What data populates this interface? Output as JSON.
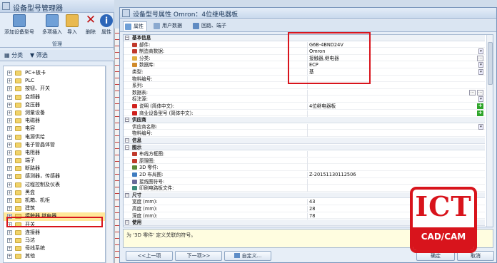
{
  "left_window": {
    "title": "设备型号管理器",
    "toolbar": [
      {
        "label": "添加设备型号",
        "icon": "add-device-icon"
      },
      {
        "label": "多项插入",
        "icon": "multi-insert-icon"
      },
      {
        "label": "导入",
        "icon": "import-icon"
      },
      {
        "label": "删除",
        "icon": "delete-icon"
      },
      {
        "label": "属性",
        "icon": "info-icon"
      }
    ],
    "group_label": "管理",
    "tabs": [
      "分类",
      "筛选"
    ],
    "tree": [
      "PC+板卡",
      "PLC",
      "按钮、开关",
      "变频器",
      "变压器",
      "测量设备",
      "电磁器",
      "电容",
      "电源供给",
      "电子管晶体管",
      "电阻器",
      "端子",
      "断路器",
      "感测器，传感器",
      "过程控制及仪表",
      "黑盒",
      "机箱、机柜",
      "建筑",
      "接触器,继电器",
      "开关",
      "连接器",
      "马达",
      "母线系统",
      "其他"
    ],
    "selected_item": "接触器,继电器"
  },
  "right_window": {
    "title": "设备型号属性 Omron：4位继电器板",
    "tabs": [
      "属性",
      "用户数据",
      "回路、端子"
    ],
    "properties": [
      {
        "type": "cat",
        "label": "基本信息"
      },
      {
        "label": "部件:",
        "value": "G6B-4BND24V",
        "icon": "pencil-icon",
        "ctrl": ""
      },
      {
        "label": "制造商数据:",
        "value": "Omron",
        "icon": "pencil-icon",
        "ctrl": "dropdown"
      },
      {
        "label": "分类:",
        "value": "接触器,继电器",
        "icon": "folder-icon",
        "ctrl": "ellipsis"
      },
      {
        "label": "数据库:",
        "value": "ECP",
        "icon": "db-icon",
        "ctrl": "dropdown"
      },
      {
        "label": "类型:",
        "value": "基",
        "icon": "",
        "ctrl": "dropdown"
      },
      {
        "label": "物料编号:",
        "value": "",
        "icon": "",
        "ctrl": ""
      },
      {
        "label": "系列:",
        "value": "",
        "icon": "",
        "ctrl": ""
      },
      {
        "label": "数据表:",
        "value": "",
        "icon": "",
        "ctrl": "ellipsis2"
      },
      {
        "label": "标注源:",
        "value": "",
        "icon": "",
        "ctrl": "dropdown"
      },
      {
        "label": "说明 (简体中文):",
        "value": "4位继电器板",
        "icon": "flag-icon",
        "ctrl": "plus"
      },
      {
        "label": "商业设备型号 (简体中文):",
        "value": "",
        "icon": "flag-icon",
        "ctrl": "plus"
      },
      {
        "type": "cat",
        "label": "供应商"
      },
      {
        "label": "供应商名称:",
        "value": "",
        "icon": "",
        "ctrl": "dropdown"
      },
      {
        "label": "物料编号:",
        "value": "",
        "icon": "",
        "ctrl": ""
      },
      {
        "type": "cat",
        "label": "信息"
      },
      {
        "type": "cat",
        "label": "图示"
      },
      {
        "label": "布线方框图:",
        "value": "",
        "icon": "pencil-icon",
        "ctrl": ""
      },
      {
        "label": "原理图:",
        "value": "",
        "icon": "pencil-icon",
        "ctrl": ""
      },
      {
        "label": "3D 零件:",
        "value": "",
        "icon": "cube-icon",
        "ctrl": ""
      },
      {
        "label": "2D 布局图:",
        "value": "Z-20151130112506",
        "icon": "layout-icon",
        "ctrl": ""
      },
      {
        "label": "接线图符号:",
        "value": "",
        "icon": "symbol-icon",
        "ctrl": ""
      },
      {
        "label": "印刷电路板文件:",
        "value": "",
        "icon": "pcb-icon",
        "ctrl": ""
      },
      {
        "type": "cat",
        "label": "尺寸"
      },
      {
        "label": "宽度 (mm):",
        "value": "43",
        "icon": "",
        "ctrl": ""
      },
      {
        "label": "高度 (mm):",
        "value": "28",
        "icon": "",
        "ctrl": ""
      },
      {
        "label": "深度 (mm):",
        "value": "78",
        "icon": "",
        "ctrl": ""
      },
      {
        "type": "cat",
        "label": "使用"
      }
    ],
    "description": "为 '3D 零件' 定义关联的符号。",
    "buttons": {
      "prev": "<<上一项",
      "next": "下一项>>",
      "custom": "自定义...",
      "ok": "确定",
      "cancel": "取消"
    }
  },
  "logo": {
    "top": "ICT",
    "bottom": "CAD/CAM"
  },
  "colors": {
    "highlight": "#d8141c",
    "logo": "#d8141c"
  }
}
